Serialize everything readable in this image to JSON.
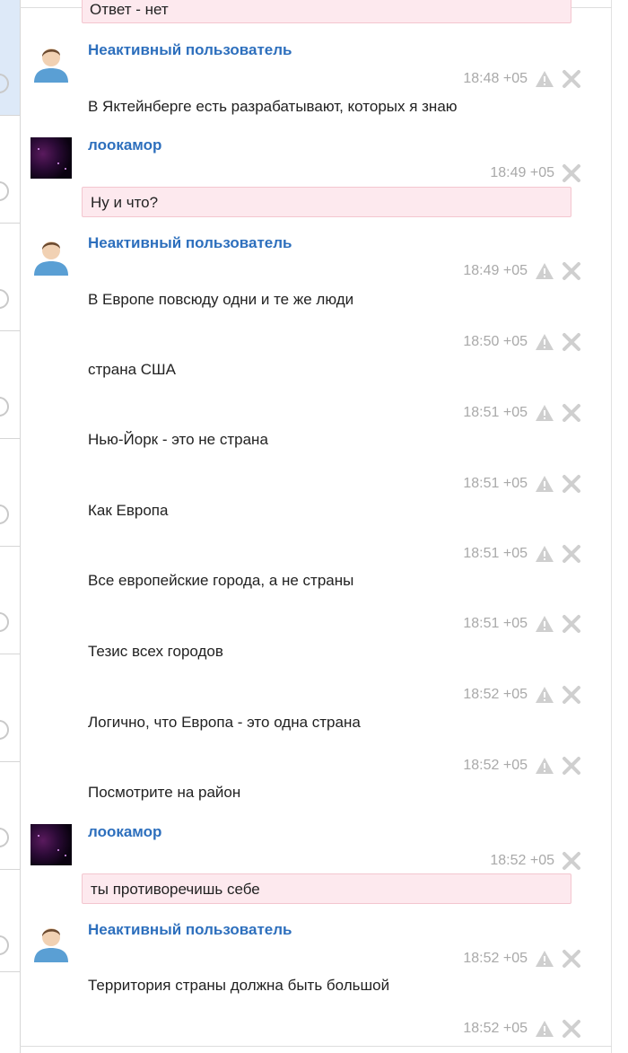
{
  "top_message": "Ответ - нет",
  "users": {
    "inactive": "Неактивный пользователь",
    "lookamor": "лоокамор"
  },
  "times": {
    "t1": "18:48 +05",
    "t2": "18:49 +05",
    "t3": "18:49 +05",
    "t4": "18:50 +05",
    "t5": "18:51 +05",
    "t6": "18:51 +05",
    "t7": "18:51 +05",
    "t8": "18:51 +05",
    "t9": "18:52 +05",
    "t10": "18:52 +05",
    "t11": "18:52 +05",
    "t12": "18:52 +05",
    "t13": "18:52 +05"
  },
  "messages": {
    "m1": "В Яктейнберге есть разрабатывают, которых я знаю",
    "m2": "Ну и что?",
    "m3": "В Европе повсюду одни и те же люди",
    "m4": "страна США",
    "m5": "Нью-Йорк - это не страна",
    "m6": "Как Европа",
    "m7": "Все европейские города, а не страны",
    "m8": "Тезис всех городов",
    "m9": "Логично, что Европа - это одна страна",
    "m10": "Посмотрите на район",
    "m11": "ты противоречишь себе",
    "m12": "Территория страны должна быть большой"
  },
  "icons": {
    "warn": "warning-triangle-icon",
    "close": "close-x-icon",
    "avatar_default": "default-user-avatar",
    "avatar_space": "space-image-avatar"
  },
  "colors": {
    "username": "#2d6fbd",
    "timestamp": "#a9a9a9",
    "bubble_bg": "#fde9ee",
    "bubble_border": "#f3c6cf",
    "selected_bg": "#dde9f8"
  }
}
